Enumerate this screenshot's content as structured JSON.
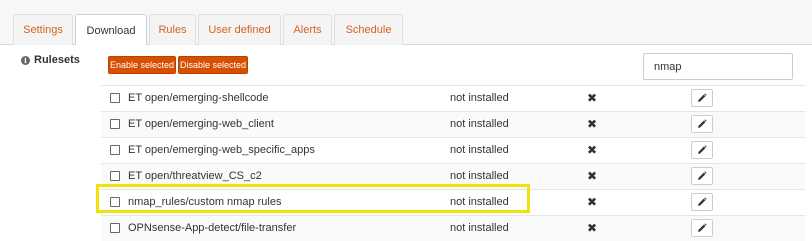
{
  "tabs": [
    {
      "label": "Settings"
    },
    {
      "label": "Download"
    },
    {
      "label": "Rules"
    },
    {
      "label": "User defined"
    },
    {
      "label": "Alerts"
    },
    {
      "label": "Schedule"
    }
  ],
  "sidebar": {
    "label": "Rulesets",
    "icon": "info-icon"
  },
  "toolbar": {
    "enable_label": "Enable selected",
    "disable_label": "Disable selected",
    "search_value": "nmap"
  },
  "rulesets": [
    {
      "name": "ET open/emerging-shellcode",
      "status": "not installed"
    },
    {
      "name": "ET open/emerging-web_client",
      "status": "not installed"
    },
    {
      "name": "ET open/emerging-web_specific_apps",
      "status": "not installed"
    },
    {
      "name": "ET open/threatview_CS_c2",
      "status": "not installed"
    },
    {
      "name": "nmap_rules/custom nmap rules",
      "status": "not installed"
    },
    {
      "name": "OPNsense-App-detect/file-transfer",
      "status": "not installed"
    }
  ],
  "colors": {
    "accent": "#d4641c",
    "button": "#d94f00",
    "highlight": "#f0e20a"
  }
}
